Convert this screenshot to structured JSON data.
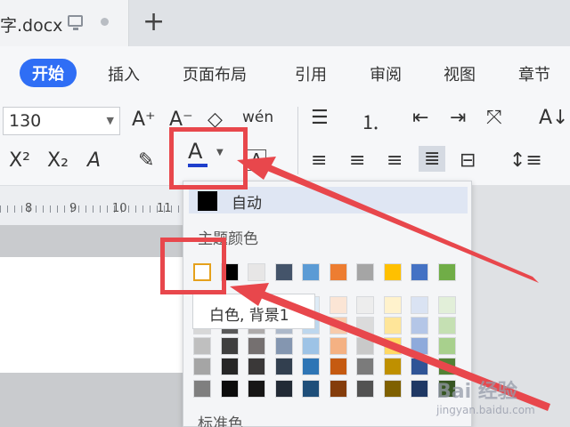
{
  "titlebar": {
    "doc_tab_name": "字.docx",
    "new_tab": "+"
  },
  "menu": [
    "开始",
    "插入",
    "页面布局",
    "引用",
    "审阅",
    "视图",
    "章节"
  ],
  "ribbon": {
    "font_size": "130",
    "font_color_letter": "A",
    "icons": {
      "grow": "A⁺",
      "shrink": "A⁻",
      "clear": "◇",
      "pinyin": "wén",
      "bullets": "☰",
      "superscript": "X²",
      "subscript": "X₂",
      "text_effect": "A",
      "highlight": "✎",
      "char_border": "A"
    }
  },
  "ruler": [
    "8",
    "9",
    "10",
    "11"
  ],
  "dropdown": {
    "auto_label": "自动",
    "theme_label": "主题颜色",
    "standard_label": "标准色",
    "tooltip": "白色, 背景1",
    "theme_colors": [
      "#ffffff",
      "#000000",
      "#e7e6e6",
      "#44546a",
      "#5b9bd5",
      "#ed7d31",
      "#a5a5a5",
      "#ffc000",
      "#4472c4",
      "#70ad47"
    ],
    "shade_rows": [
      [
        "#f2f2f2",
        "#7f7f7f",
        "#d0cece",
        "#d6dce4",
        "#deebf6",
        "#fbe5d5",
        "#ededed",
        "#fff2cc",
        "#dae3f3",
        "#e2efd9"
      ],
      [
        "#d8d8d8",
        "#595959",
        "#aeabab",
        "#adb9ca",
        "#bdd7ee",
        "#f7cbac",
        "#dbdbdb",
        "#fee599",
        "#b4c6e7",
        "#c5e0b3"
      ],
      [
        "#bfbfbf",
        "#3f3f3f",
        "#757070",
        "#8496b0",
        "#9dc3e6",
        "#f4b183",
        "#c9c9c9",
        "#ffd965",
        "#8eaadb",
        "#a8d08d"
      ],
      [
        "#a5a5a5",
        "#262626",
        "#3a3838",
        "#323f4f",
        "#2e75b5",
        "#c55a11",
        "#7b7b7b",
        "#bf9000",
        "#2f5496",
        "#538135"
      ],
      [
        "#7f7f7f",
        "#0c0c0c",
        "#171616",
        "#222a35",
        "#1e4e79",
        "#843c0b",
        "#525252",
        "#7f6000",
        "#1f3864",
        "#375623"
      ]
    ]
  },
  "annotation_color": "#e8474c",
  "watermark": {
    "logo": "Bai 经验",
    "url": "jingyan.baidu.com"
  }
}
